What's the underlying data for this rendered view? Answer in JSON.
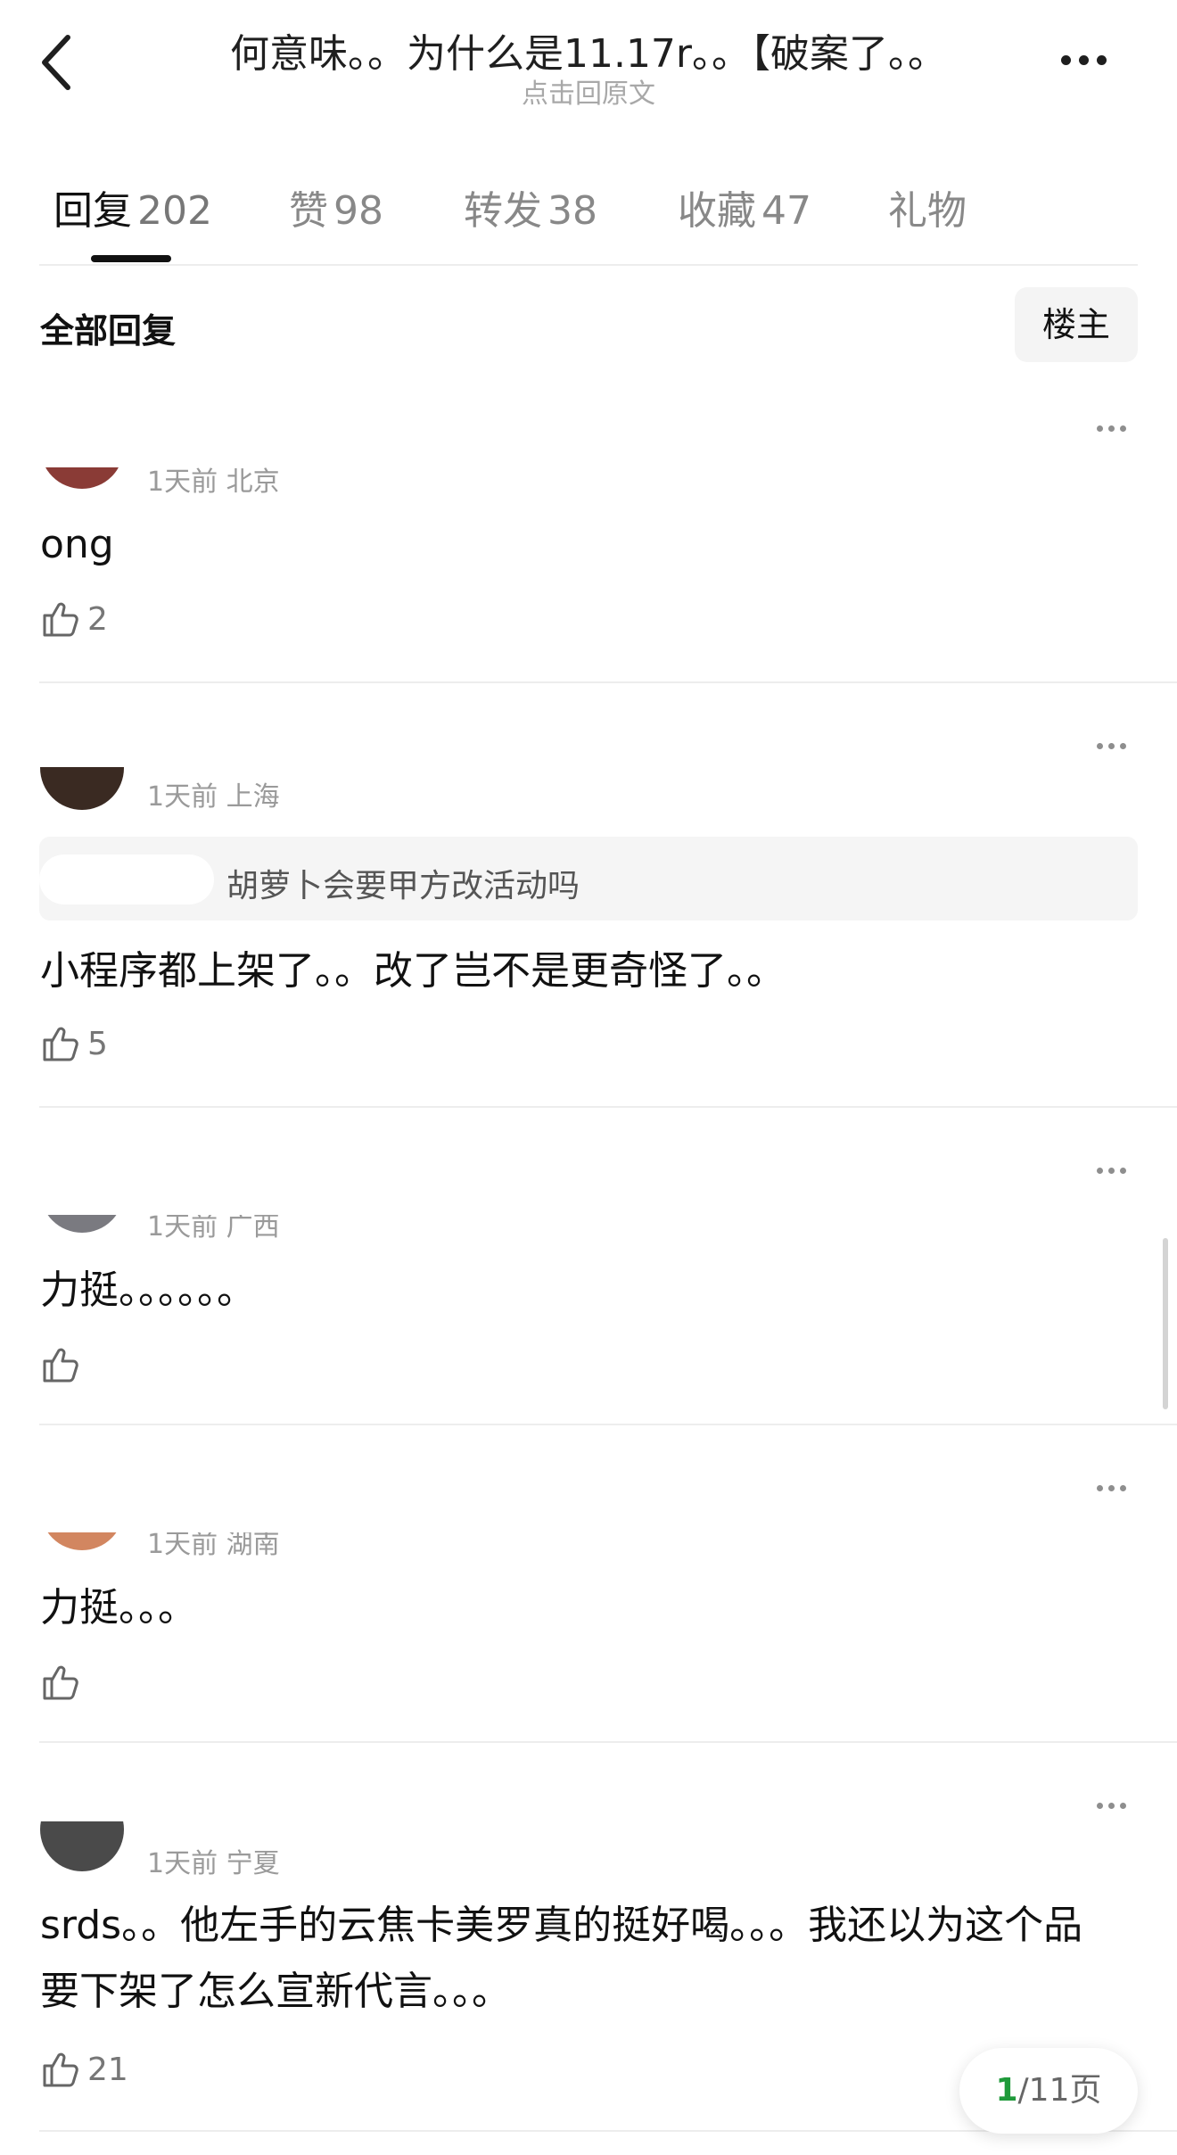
{
  "header": {
    "title": "何意味。。为什么是11.17r。。【破案了。。",
    "subtitle": "点击回原文",
    "back_icon": "chevron-left-icon",
    "more_icon": "more-horizontal-icon"
  },
  "tabs": [
    {
      "label": "回复",
      "count": "202",
      "active": true
    },
    {
      "label": "赞",
      "count": "98",
      "active": false
    },
    {
      "label": "转发",
      "count": "38",
      "active": false
    },
    {
      "label": "收藏",
      "count": "47",
      "active": false
    },
    {
      "label": "礼物",
      "count": "",
      "active": false
    }
  ],
  "filter": {
    "all_replies_label": "全部回复",
    "op_only_label": "楼主"
  },
  "comments": [
    {
      "meta": "1天前 北京",
      "text": "ong",
      "likes": "2"
    },
    {
      "meta": "1天前 上海",
      "quote": "胡萝卜会要甲方改活动吗",
      "text": "小程序都上架了。。改了岂不是更奇怪了。。",
      "likes": "5"
    },
    {
      "meta": "1天前 广西",
      "text": "力挺。。。。。。",
      "likes": ""
    },
    {
      "meta": "1天前 湖南",
      "text": "力挺。。。",
      "likes": ""
    },
    {
      "meta": "1天前 宁夏",
      "text": "srds。。他左手的云焦卡美罗真的挺好喝。。。我还以为这个品要下架了怎么宣新代言。。。",
      "likes": "21"
    }
  ],
  "pagination": {
    "current": "1",
    "total_label": "/11页"
  },
  "colors": {
    "accent_green": "#1f9a3a",
    "text_primary": "#111111",
    "text_secondary": "#9a9a9a"
  }
}
